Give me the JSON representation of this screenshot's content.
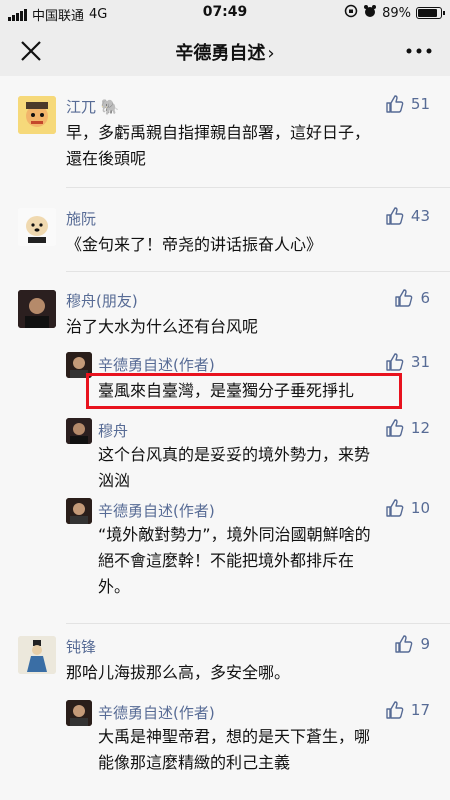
{
  "status": {
    "carrier": "中国联通",
    "network": "4G",
    "time": "07:49",
    "battery": "89%",
    "battery_level": 0.89
  },
  "nav": {
    "title": "辛德勇自述",
    "chevron": "›"
  },
  "comments": [
    {
      "name": "江兀",
      "emoji": "🐘",
      "likes": "51",
      "lines": [
        "早，多虧禹親自指揮親自部署，這好日子，",
        "還在後頭呢"
      ]
    },
    {
      "name": "施阮",
      "likes": "43",
      "lines": [
        "《金句来了！帝尧的讲话振奋人心》"
      ]
    },
    {
      "name": "穆舟(朋友)",
      "likes": "6",
      "lines": [
        "治了大水为什么还有台风呢"
      ],
      "replies": [
        {
          "name": "辛德勇自述(作者)",
          "likes": "31",
          "lines": [
            "臺風來自臺灣，是臺獨分子垂死掙扎"
          ]
        },
        {
          "name": "穆舟",
          "likes": "12",
          "lines": [
            "这个台风真的是妥妥的境外勢力，来势",
            "汹汹"
          ]
        },
        {
          "name": "辛德勇自述(作者)",
          "likes": "10",
          "lines": [
            "“境外敵對勢力”，境外同治國朝鮮啥的",
            "絕不會這麼幹！不能把境外都排斥在",
            "外。"
          ]
        }
      ]
    },
    {
      "name": "钝锋",
      "likes": "9",
      "lines": [
        "那哈儿海拔那么高，多安全哪。"
      ],
      "replies": [
        {
          "name": "辛德勇自述(作者)",
          "likes": "17",
          "lines": [
            "大禹是神聖帝君，想的是天下蒼生，哪",
            "能像那這麼精緻的利己主義"
          ]
        }
      ]
    }
  ],
  "colors": {
    "link": "#576b95",
    "highlight": "#e8121e",
    "background": "#f7f7f7"
  }
}
